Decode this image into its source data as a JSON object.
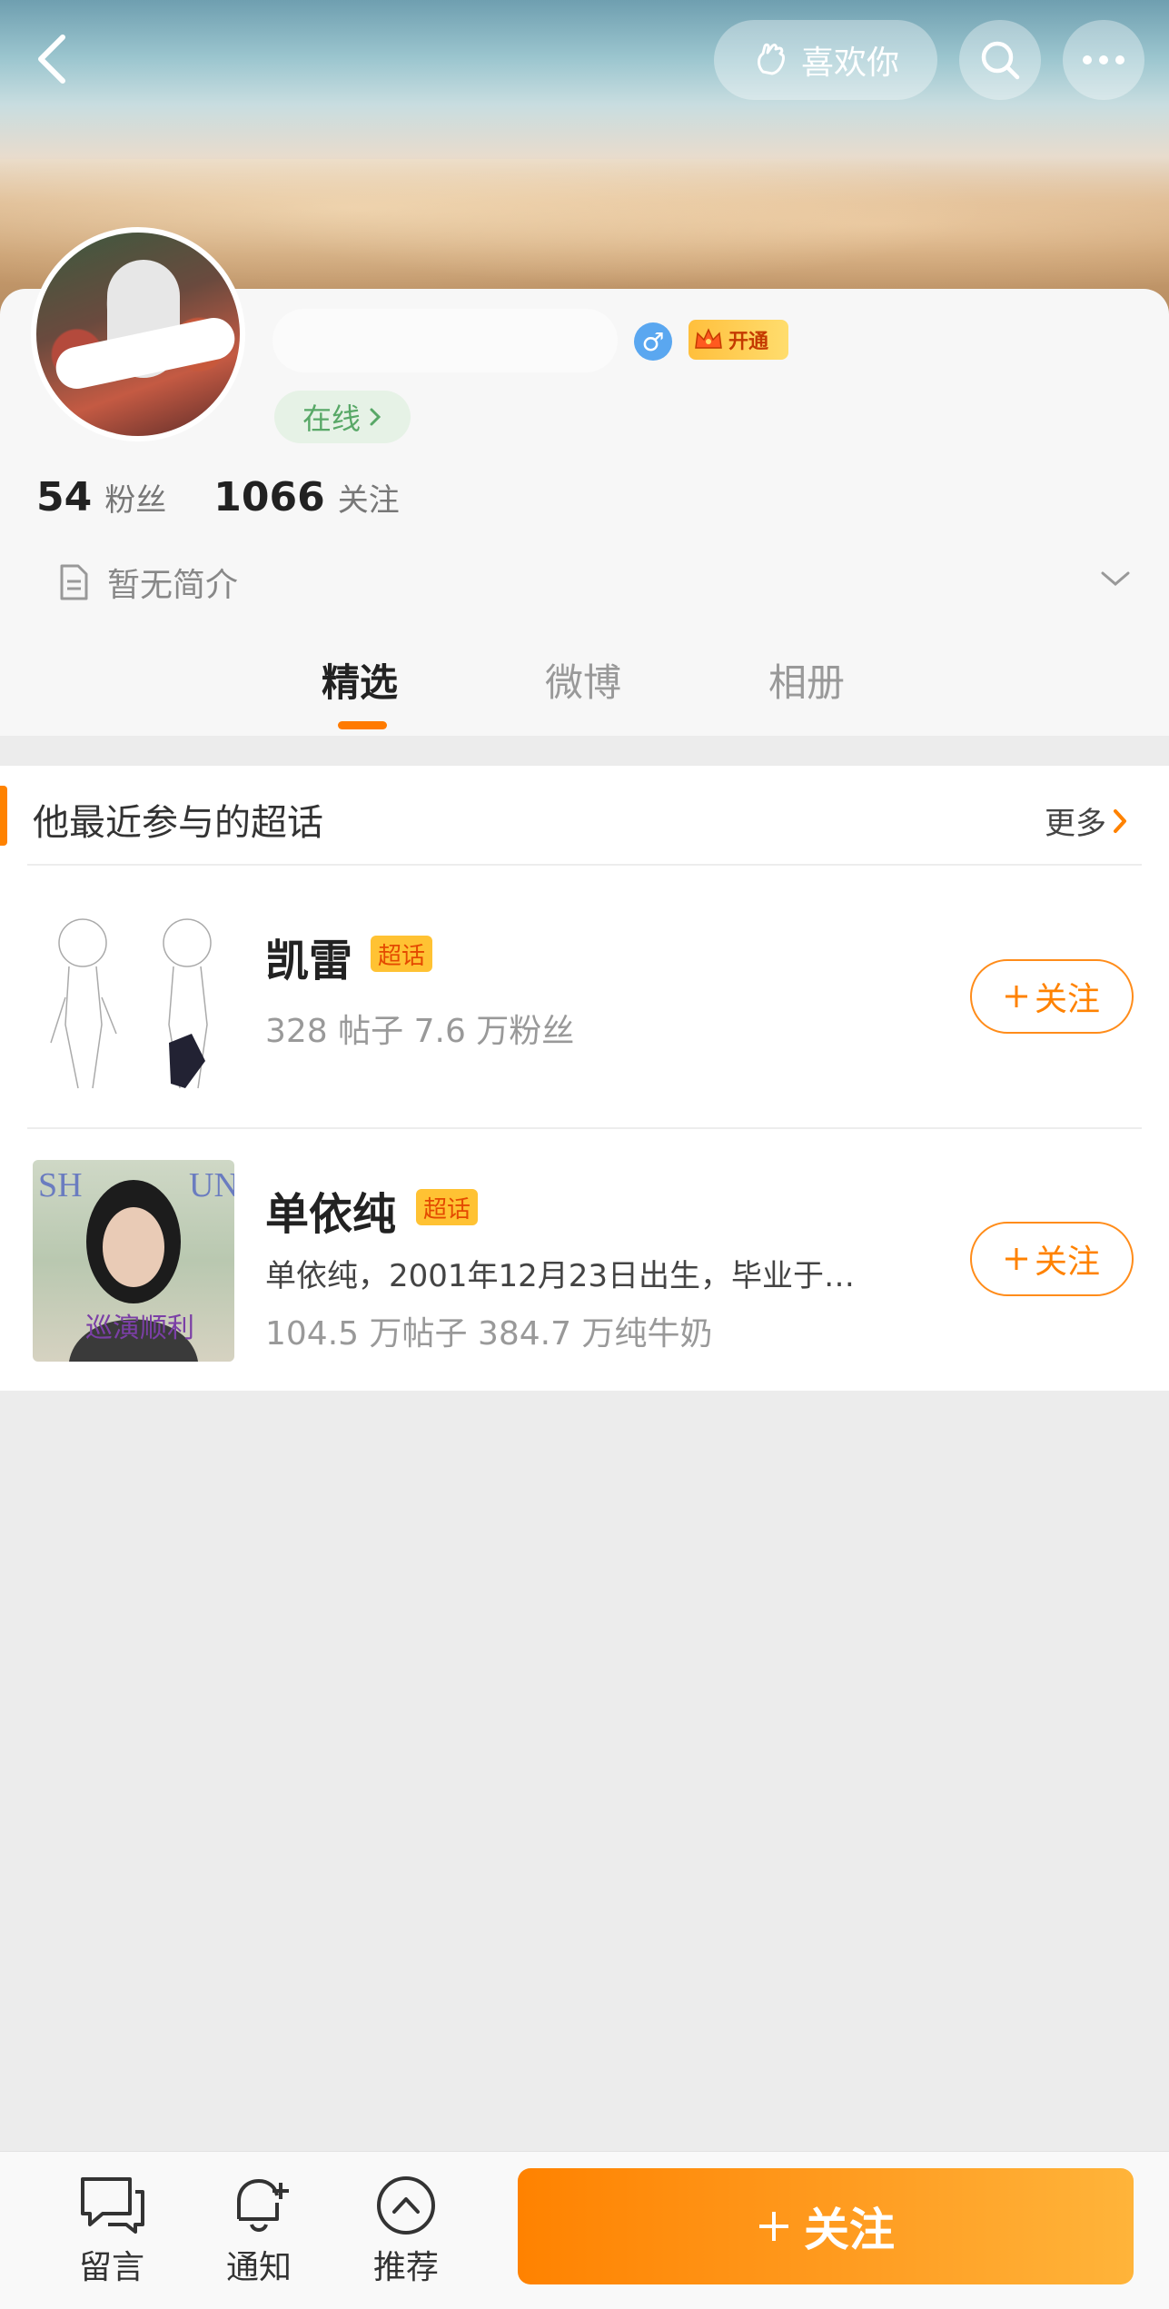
{
  "header": {
    "like_label": "喜欢你"
  },
  "profile": {
    "gender_symbol": "♂",
    "vip_label": "开通",
    "online_label": "在线",
    "fans_count": "54",
    "fans_label": "粉丝",
    "following_count": "1066",
    "following_label": "关注",
    "bio": "暂无简介"
  },
  "tabs": [
    {
      "label": "精选",
      "active": true
    },
    {
      "label": "微博",
      "active": false
    },
    {
      "label": "相册",
      "active": false
    }
  ],
  "super_topics": {
    "title": "他最近参与的超话",
    "more_label": "更多",
    "items": [
      {
        "name": "凯雷",
        "badge": "超话",
        "meta": "328 帖子 7.6 万粉丝",
        "follow_label": "关注"
      },
      {
        "name": "单依纯",
        "badge": "超话",
        "description": "单依纯，2001年12月23日出生，毕业于…",
        "meta": "104.5 万帖子 384.7 万纯牛奶",
        "follow_label": "关注",
        "thumb_text": "巡演顺利"
      }
    ]
  },
  "bottom_bar": {
    "message_label": "留言",
    "notify_label": "通知",
    "recommend_label": "推荐",
    "follow_label": "关注"
  },
  "colors": {
    "accent": "#ff8200",
    "online_green": "#58a867",
    "gender_blue": "#5aa7f0"
  },
  "icons": [
    "back-icon",
    "heart-hand-icon",
    "search-icon",
    "more-icon",
    "crown-icon",
    "chevron-right-icon",
    "doc-icon",
    "chevron-down-icon",
    "plus-icon",
    "message-icon",
    "bell-icon",
    "recommend-icon"
  ]
}
